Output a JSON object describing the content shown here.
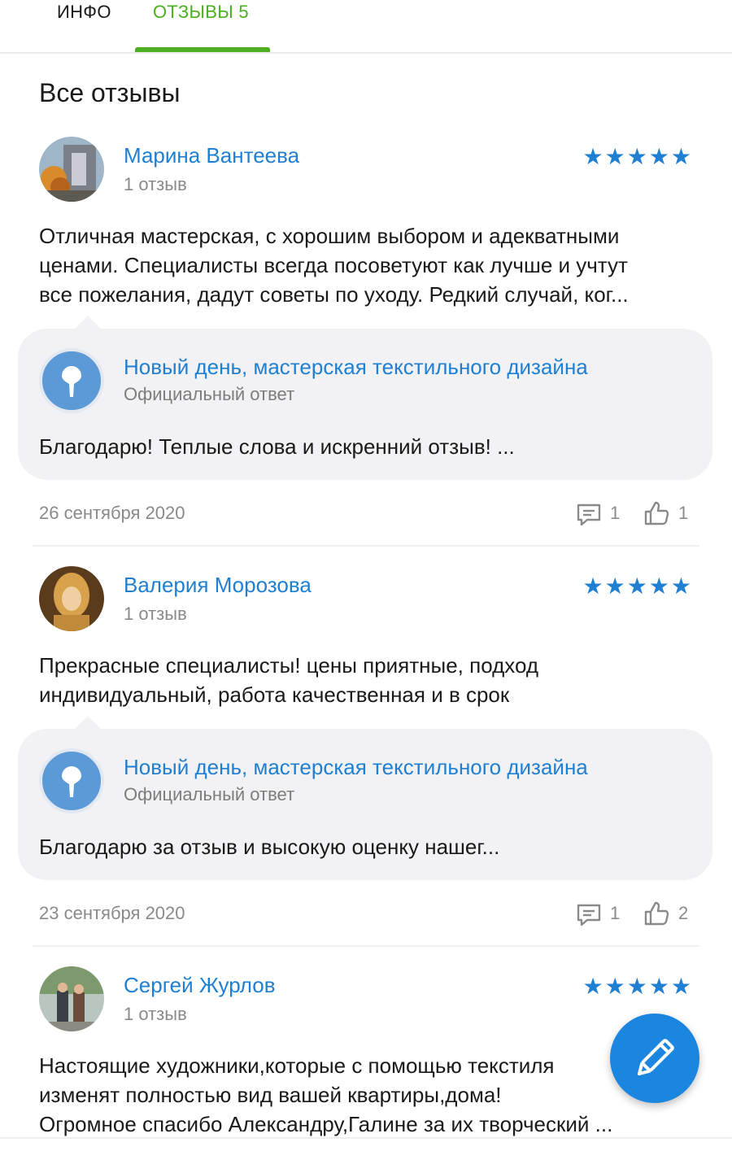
{
  "tabs": {
    "info": "ИНФО",
    "reviews": "ОТЗЫВЫ 5"
  },
  "section_title": "Все отзывы",
  "accent_color": "#4caf1f",
  "link_color": "#1f7fd1",
  "reviews": [
    {
      "author": "Марина Вантеева",
      "author_sub": "1 отзыв",
      "rating": 5,
      "stars": "★★★★★",
      "text_lines": [
        "Отличная мастерская, с хорошим выбором и адекватными",
        "ценами. Специалисты всегда посоветуют как лучше и учтут",
        "все пожелания, дадут советы по уходу. Редкий случай, ког..."
      ],
      "reply": {
        "name": "Новый день, мастерская текстильного дизайна",
        "sub": "Официальный ответ",
        "text": "Благодарю! Теплые слова и искренний отзыв! ..."
      },
      "date": "26 сентября 2020",
      "comments": "1",
      "likes": "1"
    },
    {
      "author": "Валерия Морозова",
      "author_sub": "1 отзыв",
      "rating": 5,
      "stars": "★★★★★",
      "text_lines": [
        "Прекрасные специалисты! цены приятные, подход",
        "индивидуальный, работа качественная и в срок"
      ],
      "reply": {
        "name": "Новый день, мастерская текстильного дизайна",
        "sub": "Официальный ответ",
        "text": "Благодарю за отзыв и высокую оценку нашег..."
      },
      "date": "23 сентября 2020",
      "comments": "1",
      "likes": "2"
    },
    {
      "author": "Сергей Журлов",
      "author_sub": "1 отзыв",
      "rating": 5,
      "stars": "★★★★★",
      "text_lines": [
        "Настоящие художники,которые с помощью текстиля",
        "изменят полностью вид вашей квартиры,дома!",
        "Огромное спасибо Александру,Галине за их творческий ..."
      ]
    }
  ],
  "fab_icon": "pencil-icon"
}
